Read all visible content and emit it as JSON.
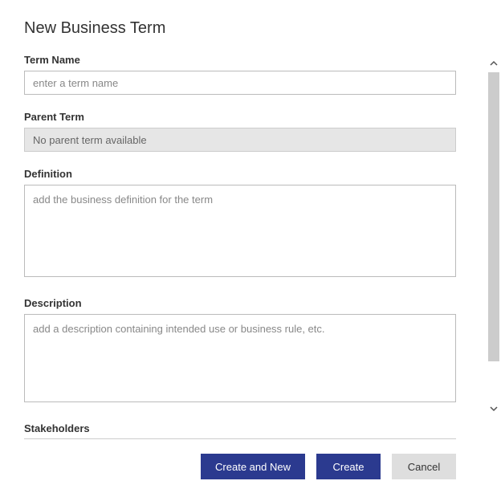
{
  "page": {
    "title": "New Business Term"
  },
  "form": {
    "termName": {
      "label": "Term Name",
      "placeholder": "enter a term name",
      "value": ""
    },
    "parentTerm": {
      "label": "Parent Term",
      "value": "No parent term available"
    },
    "definition": {
      "label": "Definition",
      "placeholder": "add the business definition for the term",
      "value": ""
    },
    "description": {
      "label": "Description",
      "placeholder": "add a description containing intended use or business rule, etc.",
      "value": ""
    },
    "stakeholders": {
      "label": "Stakeholders"
    }
  },
  "buttons": {
    "createAndNew": "Create and New",
    "create": "Create",
    "cancel": "Cancel"
  }
}
